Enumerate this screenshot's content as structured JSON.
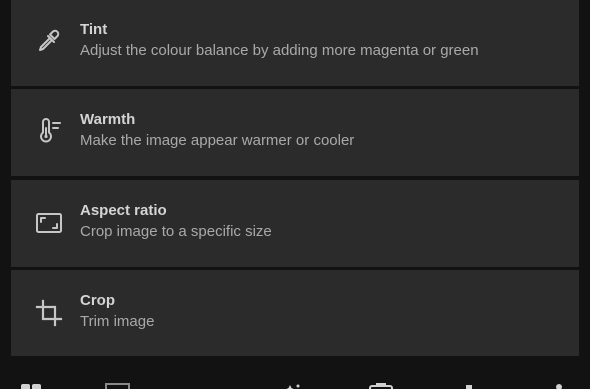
{
  "tools": [
    {
      "name": "tint",
      "icon": "eyedropper-icon",
      "title": "Tint",
      "subtitle": "Adjust the colour balance by adding more magenta or green"
    },
    {
      "name": "warmth",
      "icon": "thermometer-icon",
      "title": "Warmth",
      "subtitle": "Make the image appear warmer or cooler"
    },
    {
      "name": "aspect-ratio",
      "icon": "aspect-ratio-icon",
      "title": "Aspect ratio",
      "subtitle": "Crop image to a specific size"
    },
    {
      "name": "crop",
      "icon": "crop-icon",
      "title": "Crop",
      "subtitle": "Trim image"
    }
  ],
  "bottom_nav": {
    "icons": [
      "suggestions-icon",
      "crop-tool-icon",
      "adjust-icon",
      "tools-icon",
      "markup-icon",
      "more-icon"
    ]
  },
  "colors": {
    "background": "#121212",
    "card": "#2b2b2b",
    "title": "#d4d4d4",
    "subtitle": "#a9a9a9",
    "icon": "#c6c6c6"
  }
}
